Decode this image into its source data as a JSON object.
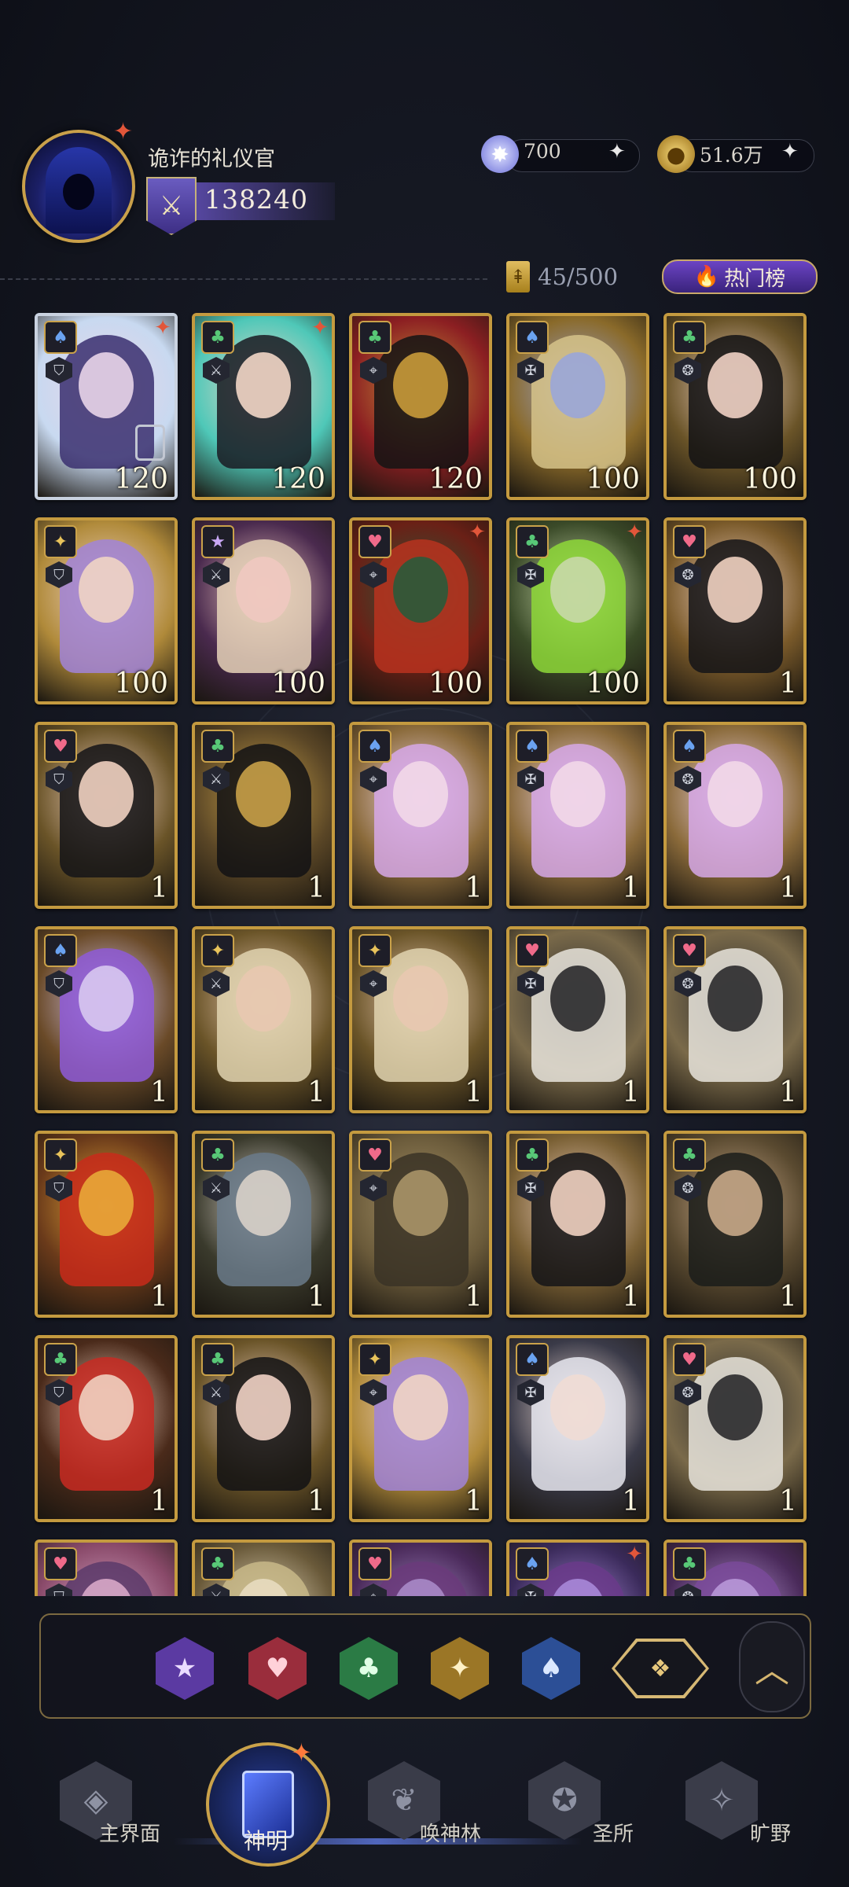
{
  "player": {
    "name": "诡诈的礼仪官",
    "power": "138240"
  },
  "currency": [
    {
      "icon": "crystal-star-icon",
      "value": "700"
    },
    {
      "icon": "gold-coin-icon",
      "value": "51.6万"
    }
  ],
  "collection": {
    "count": "45/500",
    "hot_label": "热门榜"
  },
  "cards": [
    {
      "suit": "spade",
      "level": "120",
      "frame": "silver",
      "palette": [
        "#c8d9f0",
        "#3a2f6e",
        "#e8d4e8"
      ],
      "spark": true,
      "medal": true
    },
    {
      "suit": "club",
      "level": "120",
      "frame": "gold",
      "palette": [
        "#4fc8b8",
        "#1a1a22",
        "#f2d6c6"
      ],
      "spark": true
    },
    {
      "suit": "club",
      "level": "120",
      "frame": "gold",
      "palette": [
        "#8c1f22",
        "#141414",
        "#c89a3a"
      ]
    },
    {
      "suit": "spade",
      "level": "100",
      "frame": "gold",
      "palette": [
        "#8a6a2a",
        "#d6c38a",
        "#9aa6d8"
      ]
    },
    {
      "suit": "club",
      "level": "100",
      "frame": "gold",
      "palette": [
        "#6a5428",
        "#121214",
        "#f0d2c4"
      ]
    },
    {
      "suit": "diamond",
      "level": "100",
      "frame": "gold",
      "palette": [
        "#b08a3a",
        "#a184d8",
        "#f0d4c4"
      ]
    },
    {
      "suit": "star",
      "level": "100",
      "frame": "gold",
      "palette": [
        "#4a2a4e",
        "#e6d2b8",
        "#f0c8c0"
      ]
    },
    {
      "suit": "heart",
      "level": "100",
      "frame": "gold",
      "palette": [
        "#6a2016",
        "#b8331f",
        "#2a5a3a"
      ],
      "spark": true
    },
    {
      "suit": "club",
      "level": "100",
      "frame": "gold",
      "palette": [
        "#3a4a28",
        "#8ed838",
        "#c8d8a8"
      ],
      "spark": true
    },
    {
      "suit": "heart",
      "level": "1",
      "frame": "gold",
      "palette": [
        "#7a5a2a",
        "#141418",
        "#f0d0c0"
      ]
    },
    {
      "suit": "heart",
      "level": "1",
      "frame": "gold",
      "palette": [
        "#6a5428",
        "#141418",
        "#f0d0c0"
      ]
    },
    {
      "suit": "club",
      "level": "1",
      "frame": "gold",
      "palette": [
        "#5a4626",
        "#121214",
        "#c8a048"
      ]
    },
    {
      "suit": "spade",
      "level": "1",
      "frame": "gold",
      "palette": [
        "#8a6a3a",
        "#d6a8e8",
        "#f2d8e8"
      ]
    },
    {
      "suit": "spade",
      "level": "1",
      "frame": "gold",
      "palette": [
        "#8a6a3a",
        "#d6a8e8",
        "#f2d8e8"
      ]
    },
    {
      "suit": "spade",
      "level": "1",
      "frame": "gold",
      "palette": [
        "#8a6a3a",
        "#d6a8e8",
        "#f2d8e8"
      ]
    },
    {
      "suit": "spade",
      "level": "1",
      "frame": "gold",
      "palette": [
        "#6a4a28",
        "#8e5ad8",
        "#d8c8f0"
      ]
    },
    {
      "suit": "diamond",
      "level": "1",
      "frame": "gold",
      "palette": [
        "#6a5428",
        "#e0d4b0",
        "#e8c8b0"
      ]
    },
    {
      "suit": "diamond",
      "level": "1",
      "frame": "gold",
      "palette": [
        "#6a5428",
        "#e0d4b0",
        "#e8c8b0"
      ]
    },
    {
      "suit": "heart",
      "level": "1",
      "frame": "gold",
      "palette": [
        "#7a6a4a",
        "#e8e4dc",
        "#2a2a2c"
      ]
    },
    {
      "suit": "heart",
      "level": "1",
      "frame": "gold",
      "palette": [
        "#7a6a4a",
        "#e8e4dc",
        "#2a2a2c"
      ]
    },
    {
      "suit": "diamond",
      "level": "1",
      "frame": "gold",
      "palette": [
        "#6a3a1a",
        "#c82a1a",
        "#e8a838"
      ]
    },
    {
      "suit": "club",
      "level": "1",
      "frame": "gold",
      "palette": [
        "#3a3a2c",
        "#6a7a8a",
        "#d8d0c8"
      ]
    },
    {
      "suit": "heart",
      "level": "1",
      "frame": "gold",
      "palette": [
        "#6a5a3a",
        "#3a3226",
        "#a89468"
      ]
    },
    {
      "suit": "club",
      "level": "1",
      "frame": "gold",
      "palette": [
        "#7a6034",
        "#141418",
        "#f0d0c0"
      ]
    },
    {
      "suit": "club",
      "level": "1",
      "frame": "gold",
      "palette": [
        "#5a4a30",
        "#1a1c1a",
        "#c8a888"
      ]
    },
    {
      "suit": "club",
      "level": "1",
      "frame": "gold",
      "palette": [
        "#4a2a1a",
        "#c82a22",
        "#f0d0c0"
      ]
    },
    {
      "suit": "club",
      "level": "1",
      "frame": "gold",
      "palette": [
        "#6a5428",
        "#121214",
        "#f0d2c4"
      ]
    },
    {
      "suit": "diamond",
      "level": "1",
      "frame": "gold",
      "palette": [
        "#b08a3a",
        "#a184d8",
        "#f0d4c4"
      ]
    },
    {
      "suit": "spade",
      "level": "1",
      "frame": "gold",
      "palette": [
        "#3a3a48",
        "#e8e8f0",
        "#f0dcd4"
      ]
    },
    {
      "suit": "heart",
      "level": "1",
      "frame": "gold",
      "palette": [
        "#7a6a4a",
        "#e8e4dc",
        "#2a2a2c"
      ]
    },
    {
      "suit": "heart",
      "level": "",
      "frame": "gold",
      "palette": [
        "#8a4a6a",
        "#5a3a6a",
        "#d8a8c8"
      ]
    },
    {
      "suit": "club",
      "level": "",
      "frame": "gold",
      "palette": [
        "#6a5a3a",
        "#c8b888",
        "#e8dcc0"
      ]
    },
    {
      "suit": "heart",
      "level": "",
      "frame": "gold",
      "palette": [
        "#4a2a5a",
        "#6a3a7a",
        "#a88ac8"
      ]
    },
    {
      "suit": "spade",
      "level": "",
      "frame": "gold",
      "palette": [
        "#3a2a5a",
        "#6a3a8a",
        "#a888d8"
      ],
      "spark": true
    },
    {
      "suit": "club",
      "level": "",
      "frame": "gold",
      "palette": [
        "#4a2a5a",
        "#7a4a9a",
        "#b898d8"
      ]
    }
  ],
  "filters": [
    "star",
    "heart",
    "club",
    "diamond",
    "spade",
    "all"
  ],
  "nav": [
    {
      "label": "主界面",
      "icon": "home-crest-icon"
    },
    {
      "label": "神明",
      "icon": "deity-card-icon"
    },
    {
      "label": "唤神林",
      "icon": "tree-summon-icon"
    },
    {
      "label": "圣所",
      "icon": "sanctuary-icon"
    },
    {
      "label": "旷野",
      "icon": "compass-wilds-icon"
    }
  ]
}
